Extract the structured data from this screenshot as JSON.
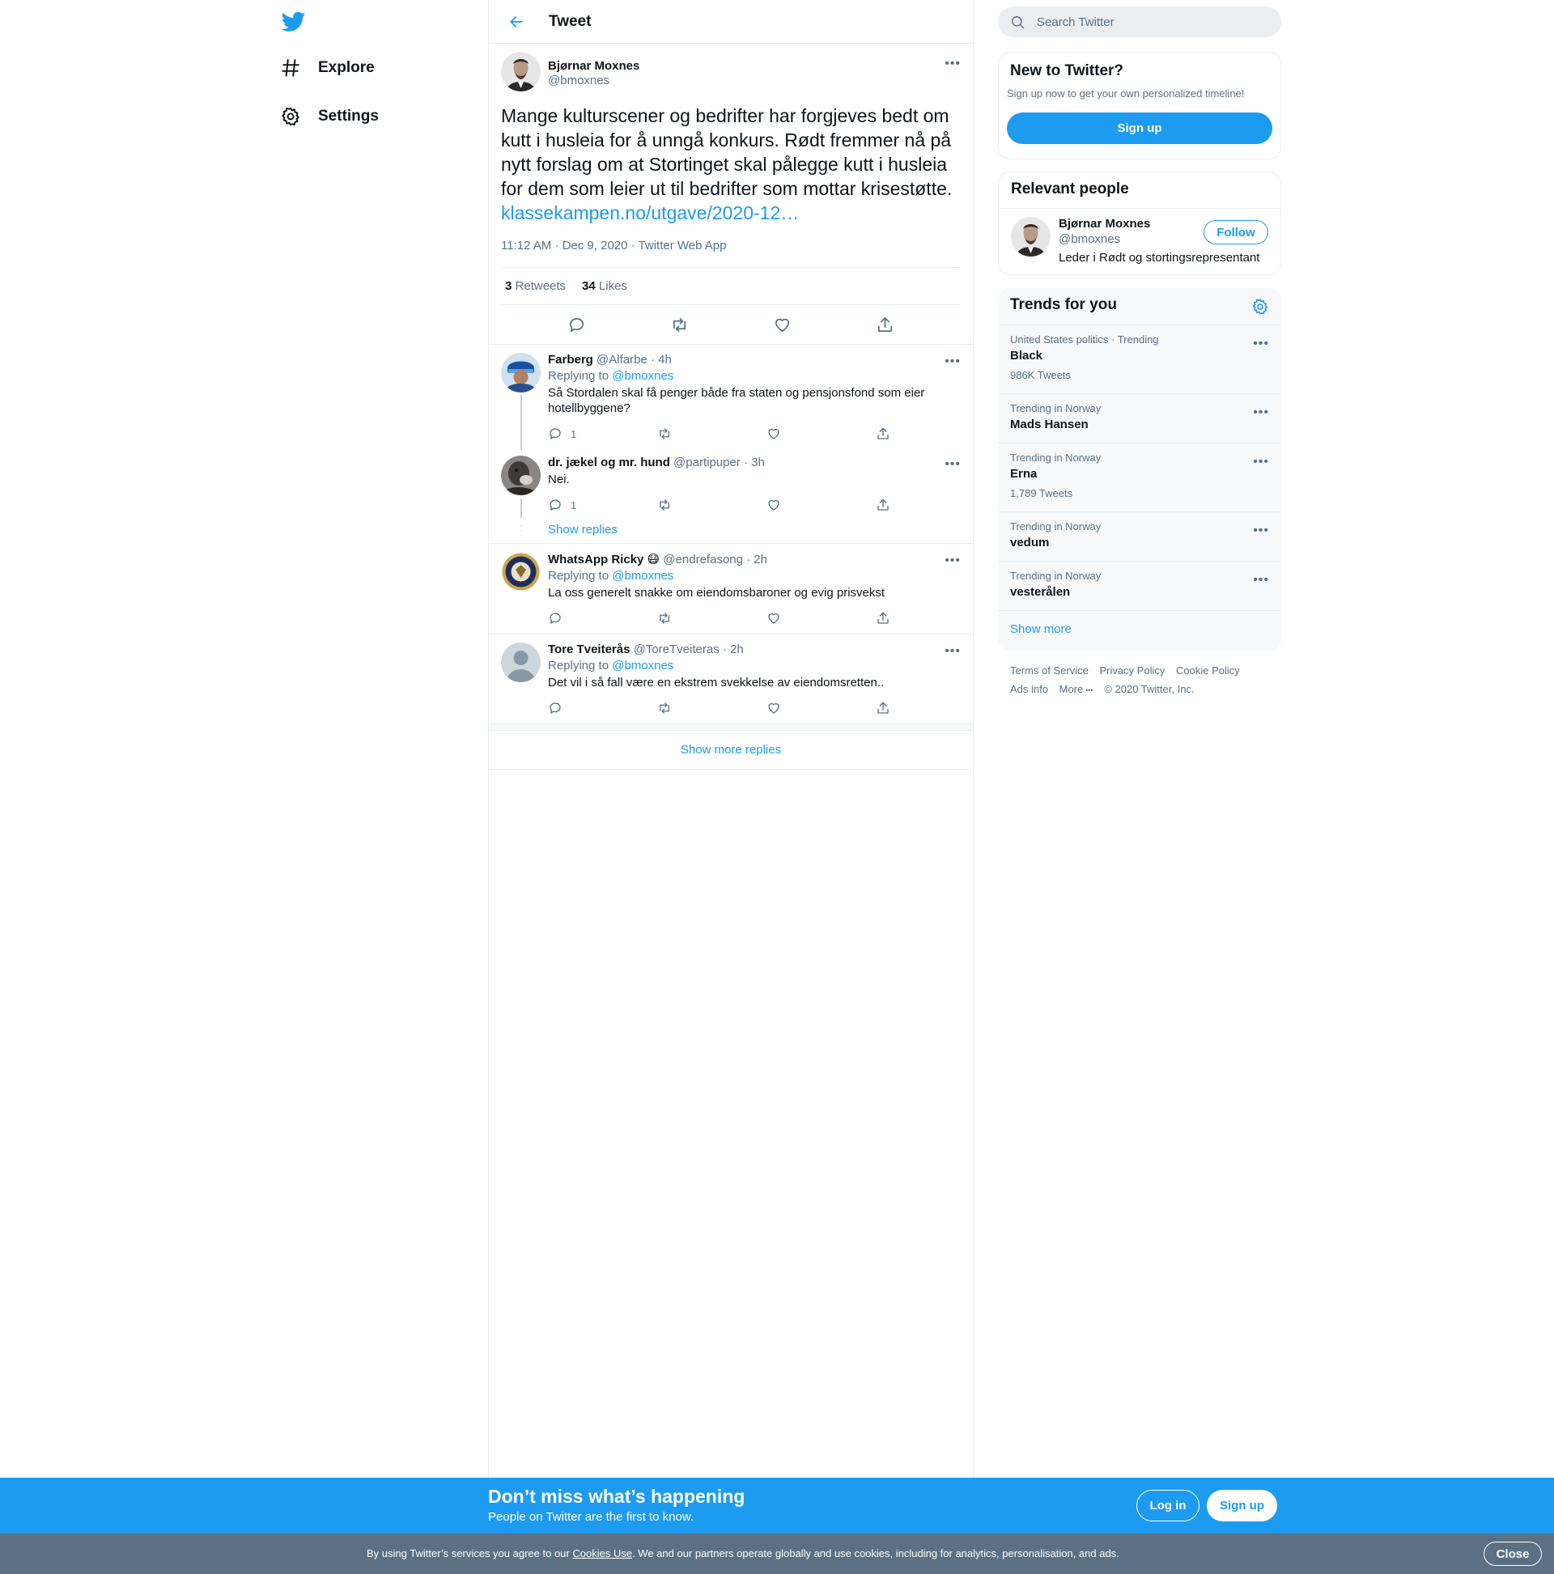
{
  "nav": {
    "explore_label": "Explore",
    "settings_label": "Settings"
  },
  "header": {
    "title": "Tweet"
  },
  "tweet": {
    "author_name": "Bjørnar Moxnes",
    "author_handle": "@bmoxnes",
    "text": "Mange kulturscener og bedrifter har forgjeves bedt om kutt i husleia for å unngå konkurs. Rødt fremmer nå på nytt forslag om at Stortinget skal pålegge kutt i husleia for dem som leier ut til bedrifter som mottar krisestøtte.",
    "link": "klassekampen.no/utgave/2020-12…",
    "meta": "11:12 AM · Dec 9, 2020 · Twitter Web App",
    "retweets_count": "3",
    "retweets_label": "Retweets",
    "likes_count": "34",
    "likes_label": "Likes"
  },
  "replies": [
    {
      "name": "Farberg",
      "meta": "@Alfarbe · 4h",
      "replying_label": "Replying to",
      "replying_to": "@bmoxnes",
      "text": "Så Stordalen skal få penger både fra staten og pensjonsfond som eier hotellbyggene?",
      "reply_count": "1"
    },
    {
      "name": "dr. jækel og mr. hund",
      "meta": "@partipuper · 3h",
      "text": "Nei.",
      "reply_count": "1",
      "show_replies": "Show replies"
    },
    {
      "name": "WhatsApp Ricky 😷",
      "meta": "@endrefasong · 2h",
      "replying_label": "Replying to",
      "replying_to": "@bmoxnes",
      "text": "La oss generelt snakke om eiendomsbaroner og evig prisvekst"
    },
    {
      "name": "Tore Tveiterås",
      "meta": "@ToreTveiteras · 2h",
      "replying_label": "Replying to",
      "replying_to": "@bmoxnes",
      "text": "Det vil i så fall være en ekstrem svekkelse av eiendomsretten.."
    }
  ],
  "show_more_replies": "Show more replies",
  "search": {
    "placeholder": "Search Twitter"
  },
  "new_to_twitter": {
    "title": "New to Twitter?",
    "subtitle": "Sign up now to get your own personalized timeline!",
    "signup_label": "Sign up"
  },
  "relevant_people": {
    "title": "Relevant people",
    "name": "Bjørnar Moxnes",
    "handle": "@bmoxnes",
    "bio": "Leder i Rødt og stortingsrepresentant",
    "follow_label": "Follow"
  },
  "trends": {
    "title": "Trends for you",
    "items": [
      {
        "context": "United States politics · Trending",
        "name": "Black",
        "count": "986K Tweets"
      },
      {
        "context": "Trending in Norway",
        "name": "Mads Hansen",
        "count": ""
      },
      {
        "context": "Trending in Norway",
        "name": "Erna",
        "count": "1,789 Tweets"
      },
      {
        "context": "Trending in Norway",
        "name": "vedum",
        "count": ""
      },
      {
        "context": "Trending in Norway",
        "name": "vesterålen",
        "count": ""
      }
    ],
    "show_more": "Show more"
  },
  "footer": {
    "terms": "Terms of Service",
    "privacy": "Privacy Policy",
    "cookie": "Cookie Policy",
    "ads": "Ads info",
    "more": "More",
    "copyright": "© 2020 Twitter, Inc."
  },
  "banner": {
    "title": "Don’t miss what’s happening",
    "subtitle": "People on Twitter are the first to know.",
    "login_label": "Log in",
    "signup_label": "Sign up"
  },
  "cookie_bar": {
    "text_before": "By using Twitter’s services you agree to our ",
    "link": "Cookies Use",
    "text_after": ". We and our partners operate globally and use cookies, including for analytics, personalisation, and ads.",
    "close_label": "Close"
  },
  "colors": {
    "accent": "#1d9bf0",
    "secondary_text": "#5b7083",
    "cookie_bar": "#5b7083"
  }
}
